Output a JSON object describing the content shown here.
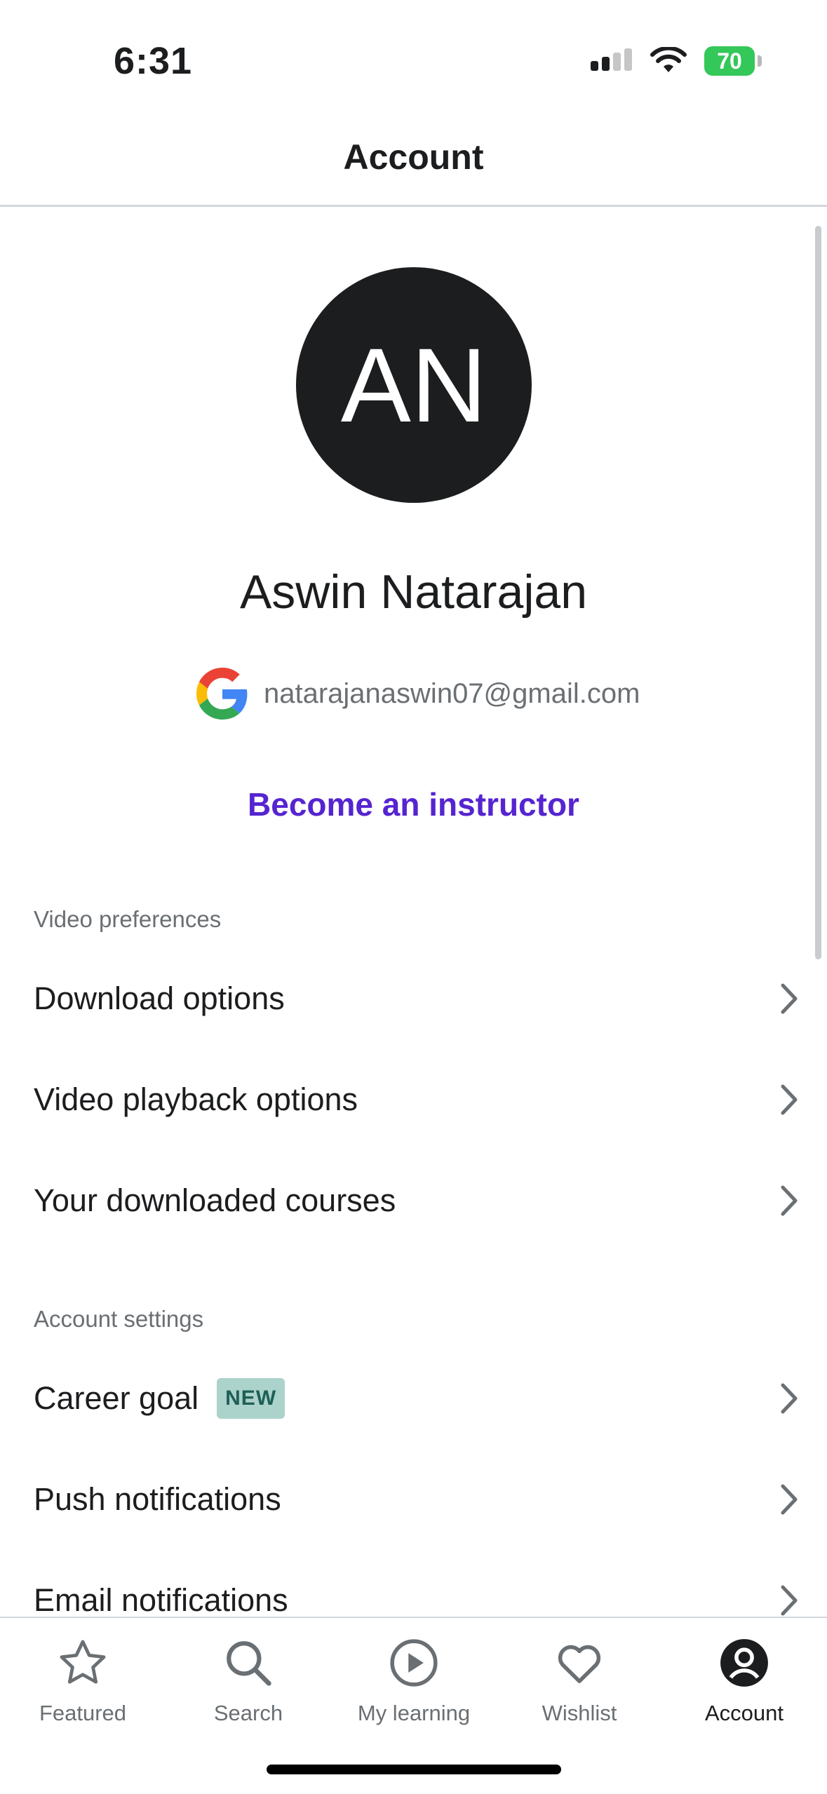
{
  "status_bar": {
    "time": "6:31",
    "battery": "70"
  },
  "header": {
    "title": "Account"
  },
  "profile": {
    "initials": "AN",
    "name": "Aswin Natarajan",
    "email": "natarajanaswin07@gmail.com",
    "become_instructor": "Become an instructor"
  },
  "sections": {
    "video": {
      "header": "Video preferences",
      "items": [
        {
          "label": "Download options"
        },
        {
          "label": "Video playback options"
        },
        {
          "label": "Your downloaded courses"
        }
      ]
    },
    "account": {
      "header": "Account settings",
      "items": [
        {
          "label": "Career goal",
          "badge": "NEW"
        },
        {
          "label": "Push notifications"
        },
        {
          "label": "Email notifications"
        }
      ]
    }
  },
  "tabs": [
    {
      "label": "Featured",
      "icon": "star-icon"
    },
    {
      "label": "Search",
      "icon": "search-icon"
    },
    {
      "label": "My learning",
      "icon": "play-circle-icon"
    },
    {
      "label": "Wishlist",
      "icon": "heart-icon"
    },
    {
      "label": "Account",
      "icon": "account-icon",
      "active": true
    }
  ],
  "colors": {
    "accent": "#5624d0",
    "text": "#1c1d1f",
    "muted": "#6a6f73",
    "badge_bg": "#acd2cc",
    "battery": "#34c759"
  }
}
